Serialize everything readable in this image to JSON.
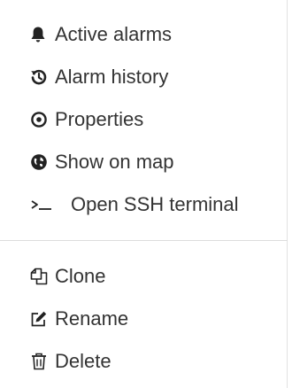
{
  "menu": {
    "top_items": [
      {
        "label": "Active alarms",
        "icon": "bell-icon"
      },
      {
        "label": "Alarm history",
        "icon": "history-icon"
      },
      {
        "label": "Properties",
        "icon": "target-icon"
      },
      {
        "label": "Show on map",
        "icon": "globe-icon"
      },
      {
        "label": "Open SSH terminal",
        "icon": "terminal-icon"
      }
    ],
    "bottom_items": [
      {
        "label": "Clone",
        "icon": "copy-icon"
      },
      {
        "label": "Rename",
        "icon": "edit-icon"
      },
      {
        "label": "Delete",
        "icon": "trash-icon"
      }
    ]
  },
  "colors": {
    "text": "#333333",
    "icon": "#222222",
    "divider": "#dcdcdc"
  }
}
